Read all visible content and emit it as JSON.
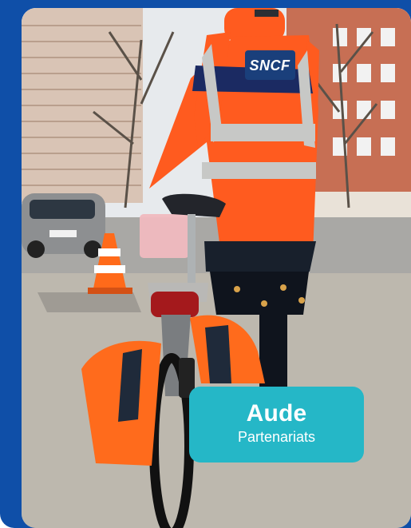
{
  "person": {
    "name": "Aude",
    "role": "Partenariats"
  },
  "photo": {
    "jacket_logo": "SNCF"
  },
  "colors": {
    "frame": "#0f4fa8",
    "card": "#25b7c7",
    "jacket_orange": "#ff5b1f",
    "reflective_stripe": "#c7c8c6",
    "logo_badge": "#1a3f7b"
  }
}
